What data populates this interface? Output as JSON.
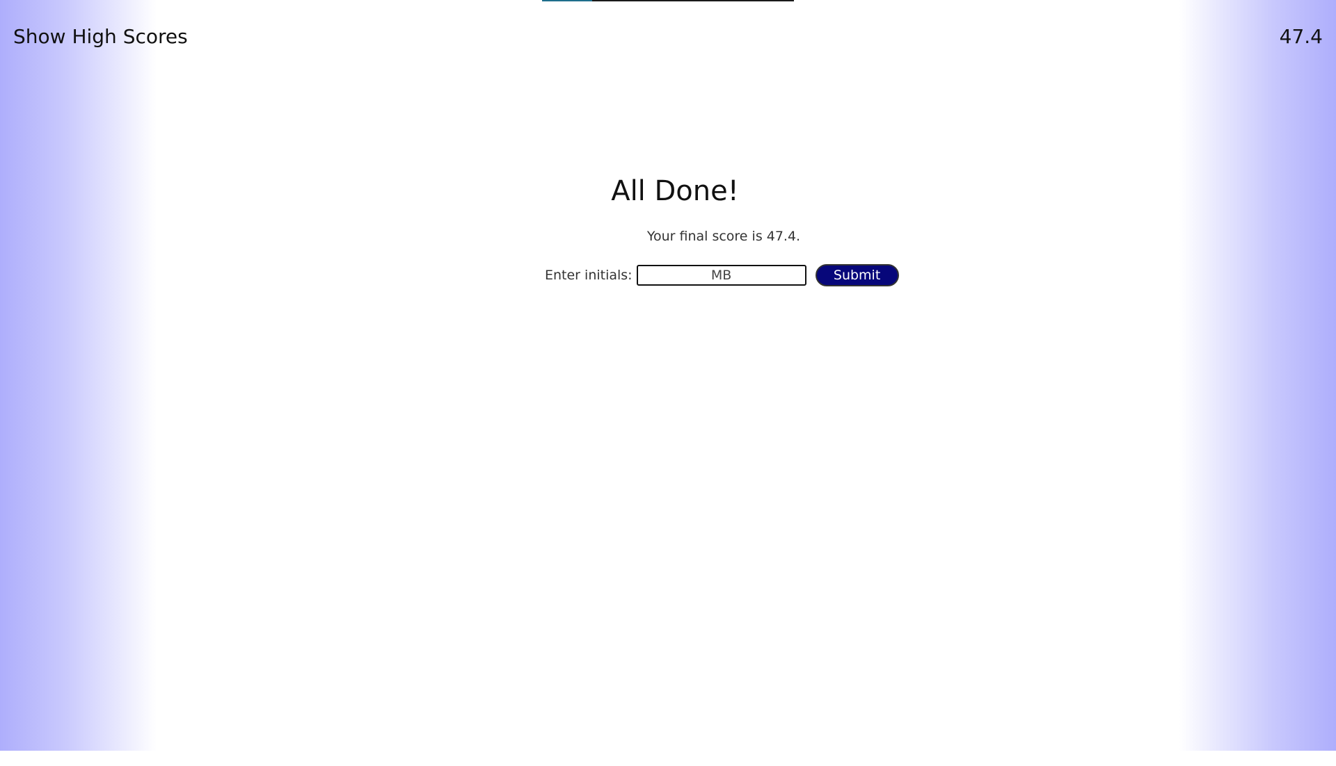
{
  "header": {
    "high_scores_label": "Show High Scores",
    "timer_value": "47.4",
    "timer_progress": 0.2
  },
  "end_screen": {
    "title": "All Done!",
    "score_text": "Your final score is 47.4.",
    "initials_label": "Enter initials:",
    "initials_value": "MB",
    "submit_label": "Submit"
  },
  "colors": {
    "side_gradient": "#aeaefc",
    "submit_background": "#07077a",
    "timer_fill": "#1f6e8c",
    "timer_track": "#1a1a1a"
  }
}
